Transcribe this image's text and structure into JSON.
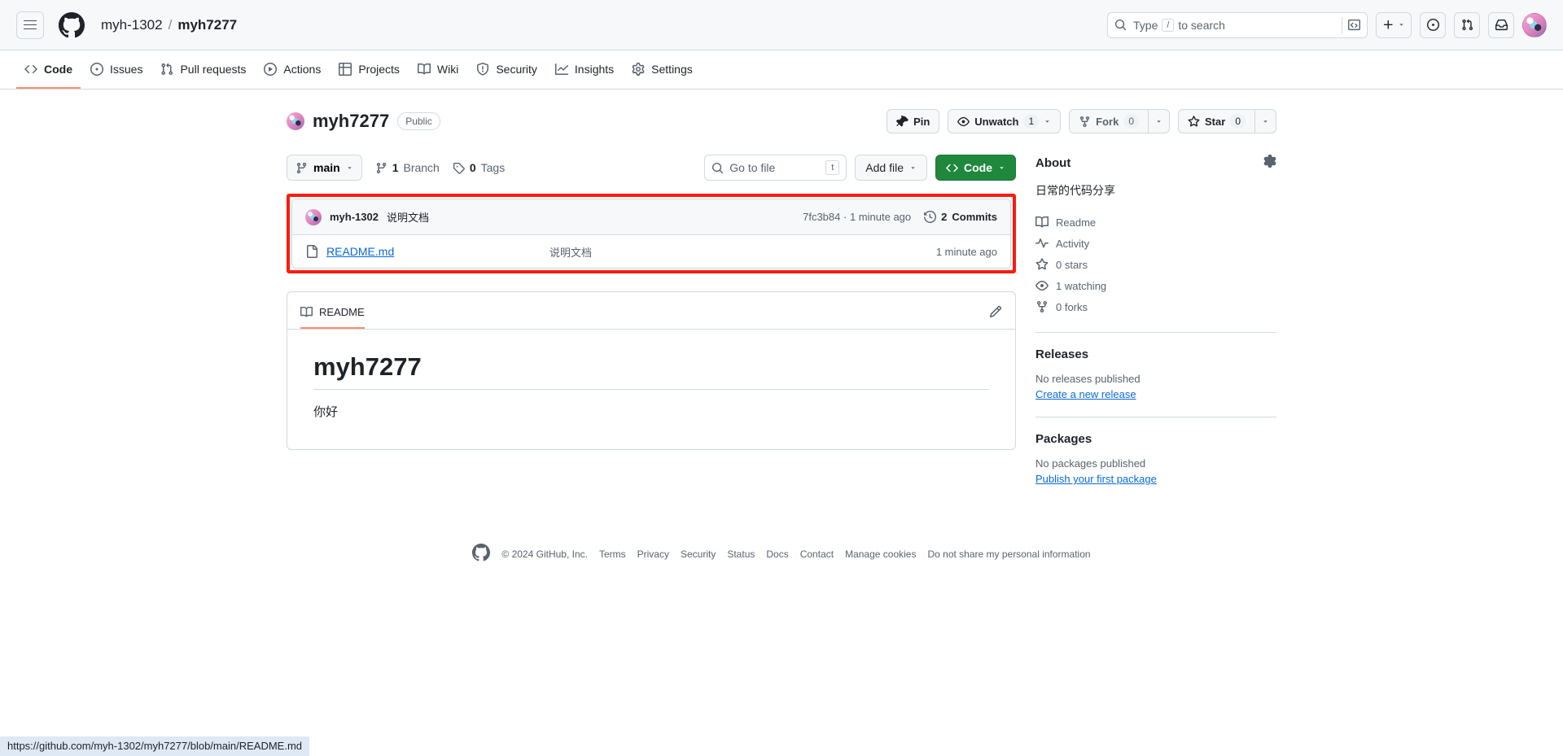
{
  "header": {
    "menu_icon": "hamburger-icon",
    "logo_icon": "github-logo-icon",
    "owner": "myh-1302",
    "separator": "/",
    "repo": "myh7277",
    "search": {
      "placeholder_prefix": "Type",
      "placeholder_key": "/",
      "placeholder_suffix": "to search",
      "terminal_icon": "command-palette-icon"
    },
    "actions": [
      {
        "name": "create-new-button",
        "icon": "plus-icon",
        "caret": true
      },
      {
        "name": "issues-button",
        "icon": "issue-opened-icon",
        "caret": false
      },
      {
        "name": "pull-requests-button",
        "icon": "git-pull-request-icon",
        "caret": false
      },
      {
        "name": "notifications-button",
        "icon": "inbox-icon",
        "caret": false
      }
    ],
    "avatar": "user-avatar"
  },
  "repo_nav": {
    "tabs": [
      {
        "label": "Code",
        "icon": "code-icon",
        "active": true
      },
      {
        "label": "Issues",
        "icon": "issue-opened-icon",
        "active": false
      },
      {
        "label": "Pull requests",
        "icon": "git-pull-request-icon",
        "active": false
      },
      {
        "label": "Actions",
        "icon": "play-icon",
        "active": false
      },
      {
        "label": "Projects",
        "icon": "table-icon",
        "active": false
      },
      {
        "label": "Wiki",
        "icon": "book-icon",
        "active": false
      },
      {
        "label": "Security",
        "icon": "shield-icon",
        "active": false
      },
      {
        "label": "Insights",
        "icon": "graph-icon",
        "active": false
      },
      {
        "label": "Settings",
        "icon": "gear-icon",
        "active": false
      }
    ]
  },
  "repo_header": {
    "name": "myh7277",
    "visibility": "Public",
    "pin_label": "Pin",
    "watch_label": "Unwatch",
    "watch_count": "1",
    "fork_label": "Fork",
    "fork_count": "0",
    "star_label": "Star",
    "star_count": "0"
  },
  "file_toolbar": {
    "branch": "main",
    "branch_count": "1",
    "branch_label": "Branch",
    "tag_count": "0",
    "tag_label": "Tags",
    "goto_file_placeholder": "Go to file",
    "goto_file_key": "t",
    "add_file_label": "Add file",
    "code_label": "Code"
  },
  "commit_row": {
    "author": "myh-1302",
    "message": "说明文档",
    "sha": "7fc3b84",
    "sha_separator": "·",
    "relative_time": "1 minute ago",
    "commits_count": "2",
    "commits_label": "Commits"
  },
  "files": [
    {
      "icon": "file-icon",
      "name": "README.md",
      "message": "说明文档",
      "time": "1 minute ago"
    }
  ],
  "readme": {
    "tab_label": "README",
    "tab_icon": "book-icon",
    "edit_icon": "pencil-icon",
    "title": "myh7277",
    "body": "你好"
  },
  "sidebar": {
    "about": {
      "heading": "About",
      "gear_icon": "gear-icon",
      "description": "日常的代码分享",
      "items": [
        {
          "icon": "book-icon",
          "label": "Readme"
        },
        {
          "icon": "pulse-icon",
          "label": "Activity"
        },
        {
          "icon": "star-icon",
          "label": "0 stars"
        },
        {
          "icon": "eye-icon",
          "label": "1 watching"
        },
        {
          "icon": "repo-forked-icon",
          "label": "0 forks"
        }
      ]
    },
    "releases": {
      "heading": "Releases",
      "empty": "No releases published",
      "link": "Create a new release"
    },
    "packages": {
      "heading": "Packages",
      "empty": "No packages published",
      "link": "Publish your first package"
    }
  },
  "footer": {
    "logo_icon": "github-mark-icon",
    "copyright": "© 2024 GitHub, Inc.",
    "links": [
      "Terms",
      "Privacy",
      "Security",
      "Status",
      "Docs",
      "Contact",
      "Manage cookies",
      "Do not share my personal information"
    ]
  },
  "statusbar": {
    "url": "https://github.com/myh-1302/myh7277/blob/main/README.md"
  },
  "colors": {
    "accent_green": "#1f883d",
    "link_blue": "#0969da",
    "highlight_red": "#fc1b0f",
    "tab_underline": "#fd8c73",
    "border": "#d1d9e0",
    "muted_text": "#59636e"
  }
}
